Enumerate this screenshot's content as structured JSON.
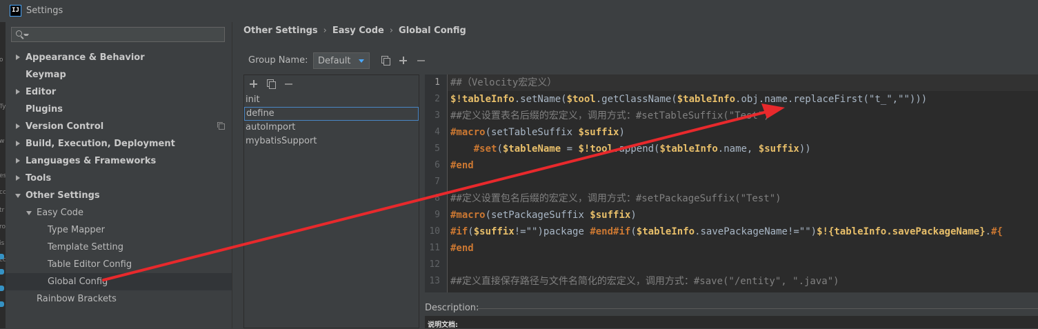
{
  "window": {
    "title": "Settings",
    "app_icon_text": "IJ"
  },
  "sidebar": {
    "search": {
      "value": "",
      "placeholder": ""
    },
    "items": [
      {
        "label": "Appearance & Behavior"
      },
      {
        "label": "Keymap"
      },
      {
        "label": "Editor"
      },
      {
        "label": "Plugins"
      },
      {
        "label": "Version Control"
      },
      {
        "label": "Build, Execution, Deployment"
      },
      {
        "label": "Languages & Frameworks"
      },
      {
        "label": "Tools"
      },
      {
        "label": "Other Settings"
      },
      {
        "label": "Easy Code"
      },
      {
        "label": "Type Mapper"
      },
      {
        "label": "Template Setting"
      },
      {
        "label": "Table Editor Config"
      },
      {
        "label": "Global Config"
      },
      {
        "label": "Rainbow Brackets"
      }
    ]
  },
  "breadcrumb": {
    "items": [
      "Other Settings",
      "Easy Code",
      "Global Config"
    ],
    "separator": "›"
  },
  "group": {
    "label": "Group Name:",
    "selected": "Default"
  },
  "list": {
    "items": [
      "init",
      "define",
      "autoImport",
      "mybatisSupport"
    ],
    "selected": "define"
  },
  "editor": {
    "line_numbers": [
      "1",
      "2",
      "3",
      "4",
      "5",
      "6",
      "7",
      "8",
      "9",
      "10",
      "11",
      "12",
      "13"
    ],
    "lines": [
      [
        {
          "t": "##（Velocity宏定义）",
          "c": "comment"
        }
      ],
      [
        {
          "t": "$!tableInfo",
          "c": "var"
        },
        {
          "t": ".setName(",
          "c": "txt"
        },
        {
          "t": "$tool",
          "c": "var"
        },
        {
          "t": ".getClassName(",
          "c": "txt"
        },
        {
          "t": "$tableInfo",
          "c": "var"
        },
        {
          "t": ".obj.name.replaceFirst(\"t_\",\"\")))",
          "c": "txt"
        }
      ],
      [
        {
          "t": "##定义设置表名后缀的宏定义，调用方式：#setTableSuffix(\"Test\")",
          "c": "comment"
        }
      ],
      [
        {
          "t": "#macro",
          "c": "dir"
        },
        {
          "t": "(setTableSuffix ",
          "c": "txt"
        },
        {
          "t": "$suffix",
          "c": "var"
        },
        {
          "t": ")",
          "c": "txt"
        }
      ],
      [
        {
          "t": "    ",
          "c": "txt"
        },
        {
          "t": "#set",
          "c": "dir"
        },
        {
          "t": "(",
          "c": "txt"
        },
        {
          "t": "$tableName",
          "c": "var"
        },
        {
          "t": " = ",
          "c": "txt"
        },
        {
          "t": "$!tool",
          "c": "var"
        },
        {
          "t": ".append(",
          "c": "txt"
        },
        {
          "t": "$tableInfo",
          "c": "var"
        },
        {
          "t": ".name, ",
          "c": "txt"
        },
        {
          "t": "$suffix",
          "c": "var"
        },
        {
          "t": "))",
          "c": "txt"
        }
      ],
      [
        {
          "t": "#end",
          "c": "dir"
        }
      ],
      [],
      [
        {
          "t": "##定义设置包名后缀的宏定义，调用方式：#setPackageSuffix(\"Test\")",
          "c": "comment"
        }
      ],
      [
        {
          "t": "#macro",
          "c": "dir"
        },
        {
          "t": "(setPackageSuffix ",
          "c": "txt"
        },
        {
          "t": "$suffix",
          "c": "var"
        },
        {
          "t": ")",
          "c": "txt"
        }
      ],
      [
        {
          "t": "#if",
          "c": "dir"
        },
        {
          "t": "(",
          "c": "txt"
        },
        {
          "t": "$suffix",
          "c": "var"
        },
        {
          "t": "!=\"\")package ",
          "c": "txt"
        },
        {
          "t": "#end#if",
          "c": "dir"
        },
        {
          "t": "(",
          "c": "txt"
        },
        {
          "t": "$tableInfo",
          "c": "var"
        },
        {
          "t": ".savePackageName!=\"\")",
          "c": "txt"
        },
        {
          "t": "$!{tableInfo.savePackageName}",
          "c": "var"
        },
        {
          "t": ".",
          "c": "txt"
        },
        {
          "t": "#{",
          "c": "dir"
        }
      ],
      [
        {
          "t": "#end",
          "c": "dir"
        }
      ],
      [],
      [
        {
          "t": "##定义直接保存路径与文件名简化的宏定义，调用方式：#save(\"/entity\", \".java\")",
          "c": "comment"
        }
      ]
    ]
  },
  "description": {
    "label": "Description:",
    "text": "说明文档:"
  },
  "colors": {
    "annotation_arrow": "#e8292c",
    "accent": "#4a88c7"
  },
  "icons": [
    "app-icon",
    "search-icon",
    "expand-arrow-icon",
    "collapse-arrow-icon",
    "copy-icon",
    "add-icon",
    "remove-icon",
    "dropdown-arrow-icon"
  ]
}
